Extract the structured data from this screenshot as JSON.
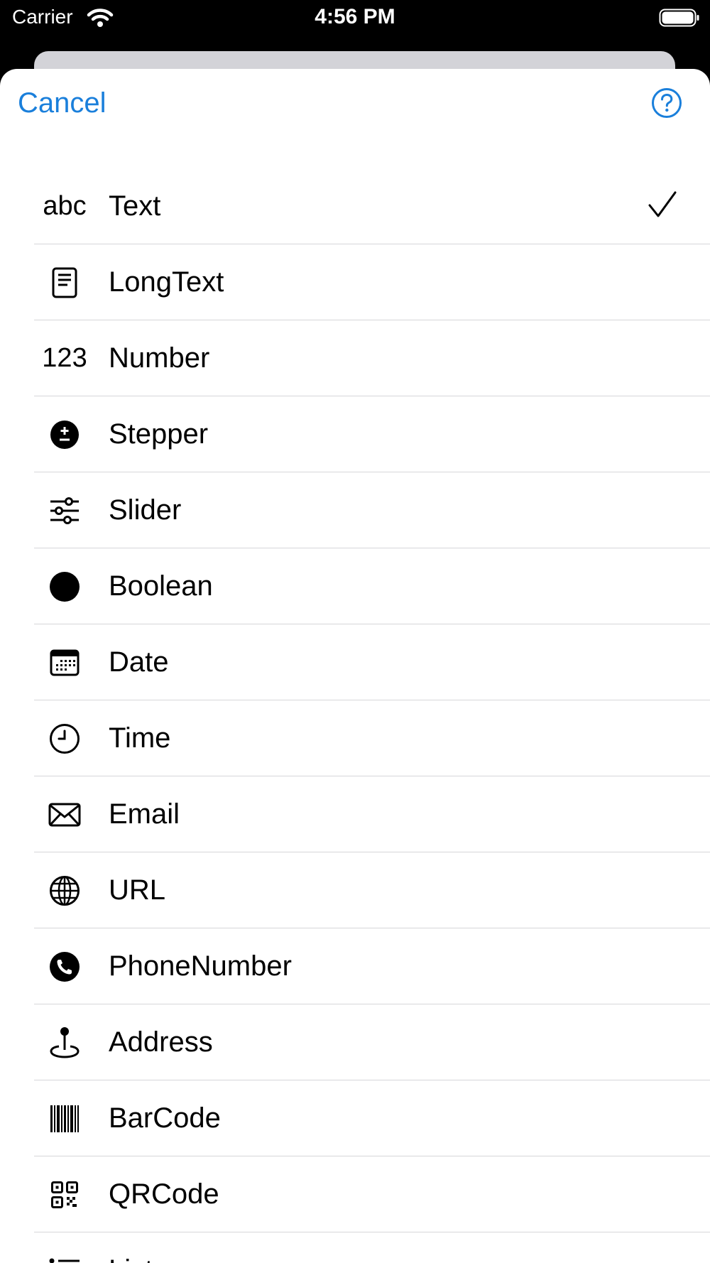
{
  "status_bar": {
    "carrier": "Carrier",
    "time": "4:56 PM"
  },
  "header": {
    "cancel_label": "Cancel"
  },
  "field_types": [
    {
      "label": "Text",
      "icon": "abc-text-icon",
      "glyph": "abc",
      "selected": true
    },
    {
      "label": "LongText",
      "icon": "document-icon"
    },
    {
      "label": "Number",
      "icon": "number-icon",
      "glyph": "123"
    },
    {
      "label": "Stepper",
      "icon": "plus-minus-circle-icon"
    },
    {
      "label": "Slider",
      "icon": "sliders-icon"
    },
    {
      "label": "Boolean",
      "icon": "filled-circle-icon"
    },
    {
      "label": "Date",
      "icon": "calendar-icon"
    },
    {
      "label": "Time",
      "icon": "clock-icon"
    },
    {
      "label": "Email",
      "icon": "envelope-icon"
    },
    {
      "label": "URL",
      "icon": "globe-icon"
    },
    {
      "label": "PhoneNumber",
      "icon": "phone-icon"
    },
    {
      "label": "Address",
      "icon": "map-pin-icon"
    },
    {
      "label": "BarCode",
      "icon": "barcode-icon"
    },
    {
      "label": "QRCode",
      "icon": "qrcode-icon"
    },
    {
      "label": "List",
      "icon": "list-icon"
    }
  ],
  "colors": {
    "accent": "#1a7fdb",
    "separator": "#d6d6d9",
    "backsheet": "#d3d3d8"
  }
}
